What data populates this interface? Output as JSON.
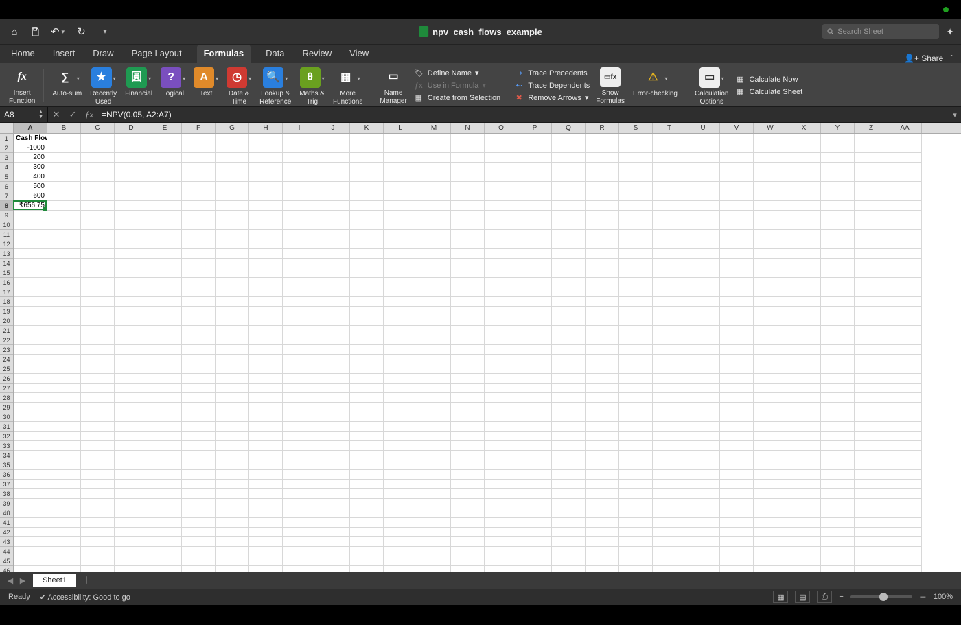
{
  "document_title": "npv_cash_flows_example",
  "search_placeholder": "Search Sheet",
  "share_label": "Share",
  "tabs": [
    "Home",
    "Insert",
    "Draw",
    "Page Layout",
    "Formulas",
    "Data",
    "Review",
    "View"
  ],
  "active_tab": "Formulas",
  "ribbon": {
    "insert_function": "Insert\nFunction",
    "auto_sum": "Auto-sum",
    "recently_used": "Recently\nUsed",
    "financial": "Financial",
    "logical": "Logical",
    "text": "Text",
    "date_time": "Date &\nTime",
    "lookup_ref": "Lookup &\nReference",
    "maths_trig": "Maths &\nTrig",
    "more_functions": "More\nFunctions",
    "name_manager": "Name\nManager",
    "define_name": "Define Name",
    "use_in_formula": "Use in Formula",
    "create_selection": "Create from Selection",
    "trace_precedents": "Trace Precedents",
    "trace_dependents": "Trace Dependents",
    "remove_arrows": "Remove Arrows",
    "show_formulas": "Show\nFormulas",
    "error_checking": "Error-checking",
    "calculation_options": "Calculation\nOptions",
    "calculate_now": "Calculate Now",
    "calculate_sheet": "Calculate Sheet"
  },
  "name_box": "A8",
  "formula": "=NPV(0.05, A2:A7)",
  "columns": [
    "A",
    "B",
    "C",
    "D",
    "E",
    "F",
    "G",
    "H",
    "I",
    "J",
    "K",
    "L",
    "M",
    "N",
    "O",
    "P",
    "Q",
    "R",
    "S",
    "T",
    "U",
    "V",
    "W",
    "X",
    "Y",
    "Z",
    "AA"
  ],
  "selected_column": "A",
  "selected_row": 8,
  "row_count": 46,
  "cells": {
    "A1": {
      "v": "Cash Flow",
      "hdr": true
    },
    "A2": {
      "v": "-1000",
      "right": true
    },
    "A3": {
      "v": "200",
      "right": true
    },
    "A4": {
      "v": "300",
      "right": true
    },
    "A5": {
      "v": "400",
      "right": true
    },
    "A6": {
      "v": "500",
      "right": true
    },
    "A7": {
      "v": "600",
      "right": true
    },
    "A8": {
      "v": "₹656.75",
      "right": true
    }
  },
  "sheet_tab": "Sheet1",
  "status_ready": "Ready",
  "status_accessibility": "Accessibility: Good to go",
  "zoom_label": "100%"
}
